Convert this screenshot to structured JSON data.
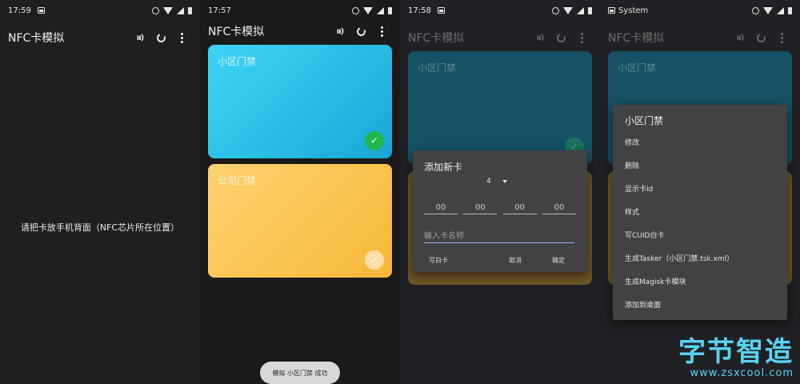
{
  "screens": [
    {
      "status": {
        "time": "17:59"
      },
      "app_title": "NFC卡模拟",
      "center_message": "请把卡放手机背面（NFC芯片所在位置）"
    },
    {
      "status": {
        "time": "17:57"
      },
      "app_title": "NFC卡模拟",
      "cards": [
        {
          "name": "小区门禁",
          "color": "#29bde3",
          "selected": true
        },
        {
          "name": "公司门禁",
          "color": "#fcc34e",
          "selected": false
        }
      ],
      "toast": "模拟 小区门禁 成功"
    },
    {
      "status": {
        "time": "17:58"
      },
      "app_title": "NFC卡模拟",
      "card_label": "小区门禁",
      "dialog": {
        "title": "添加新卡",
        "byte_count": "4",
        "hex_fields": [
          "00",
          "00",
          "00",
          "00"
        ],
        "name_placeholder": "输入卡名称",
        "btn_write": "写白卡",
        "btn_cancel": "取消",
        "btn_ok": "确定"
      }
    },
    {
      "status": {
        "label": "System"
      },
      "app_title": "NFC卡模拟",
      "card_label": "小区门禁",
      "menu": {
        "title": "小区门禁",
        "items": [
          "修改",
          "删除",
          "显示卡id",
          "样式",
          "写CUID白卡",
          "生成Tasker（小区门禁.tsk.xml）",
          "生成Magisk卡模块",
          "添加到桌面"
        ]
      }
    }
  ],
  "watermark": {
    "big": "字节智造",
    "small": "www.zsxcool.com"
  },
  "colors": {
    "accent_blue": "#8ab4f8",
    "check_green": "#21b54a",
    "watermark": "#5ad2f2"
  }
}
